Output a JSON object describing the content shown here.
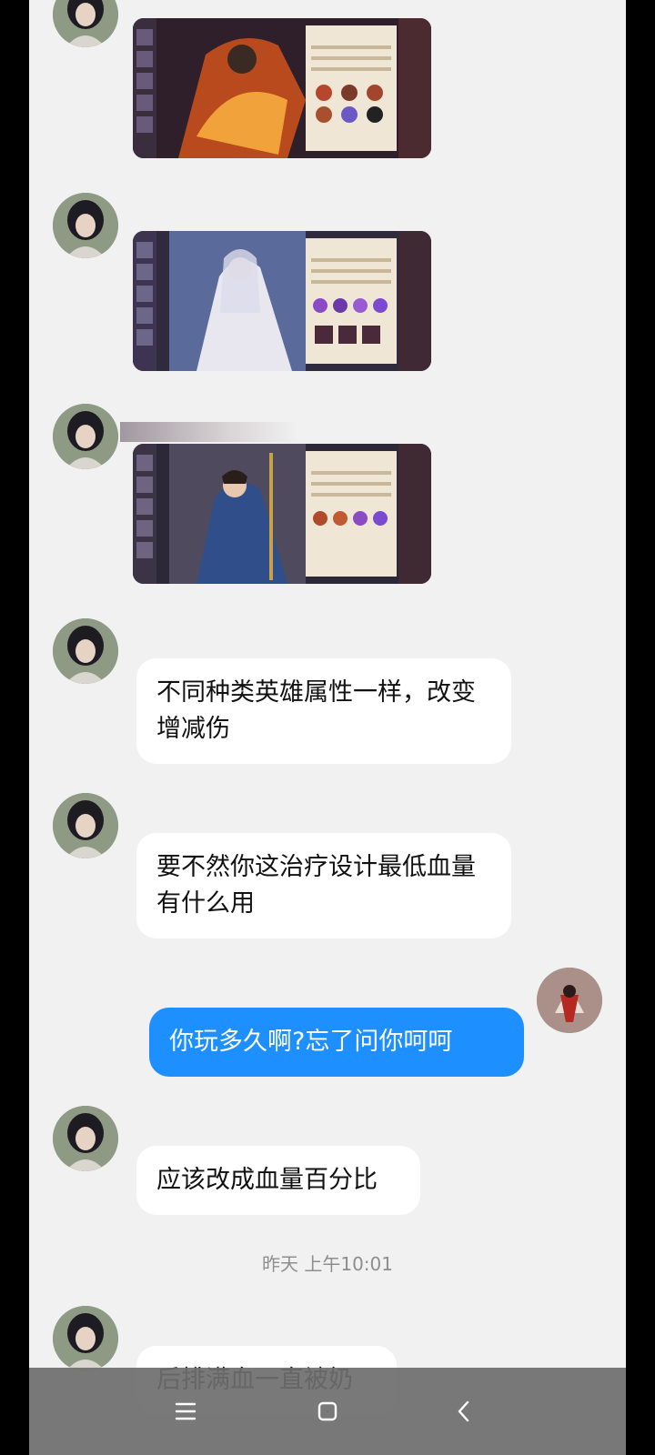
{
  "top_partial_name": "",
  "messages": [
    {
      "type": "image",
      "from": "other",
      "hero": "flame-warrior"
    },
    {
      "type": "image",
      "from": "other",
      "hero": "silver-haired-mage"
    },
    {
      "type": "image",
      "from": "other",
      "hero": "spear-warrior"
    },
    {
      "type": "text",
      "from": "other",
      "text": "不同种类英雄属性一样，改变增减伤"
    },
    {
      "type": "text",
      "from": "other",
      "text": "要不然你这治疗设计最低血量有什么用"
    },
    {
      "type": "text",
      "from": "self",
      "text": "你玩多久啊?忘了问你呵呵"
    },
    {
      "type": "text",
      "from": "other",
      "text": "应该改成血量百分比"
    },
    {
      "type": "time",
      "text": "昨天 上午10:01"
    },
    {
      "type": "text",
      "from": "other",
      "text": "后排满血一直被奶"
    }
  ],
  "navbar": {
    "menu_icon": "menu-icon",
    "home_icon": "home-square-icon",
    "back_icon": "back-chevron-icon"
  },
  "colors": {
    "chat_background": "#f1f1f1",
    "self_bubble": "#1e8fff",
    "other_bubble": "#ffffff",
    "navbar": "#6e6e6e"
  }
}
